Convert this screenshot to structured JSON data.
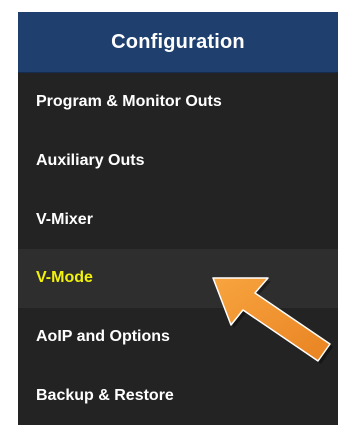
{
  "sidebar": {
    "title": "Configuration",
    "items": [
      {
        "label": "Program & Monitor Outs",
        "active": false
      },
      {
        "label": "Auxiliary Outs",
        "active": false
      },
      {
        "label": "V-Mixer",
        "active": false
      },
      {
        "label": "V-Mode",
        "active": true
      },
      {
        "label": "AoIP and Options",
        "active": false
      },
      {
        "label": "Backup & Restore",
        "active": false
      }
    ]
  },
  "colors": {
    "header_bg": "#1f3f6e",
    "panel_bg": "#232323",
    "active_text": "#f2f20a",
    "arrow": "#f0912e"
  },
  "annotation": {
    "icon": "pointer-arrow-icon"
  }
}
